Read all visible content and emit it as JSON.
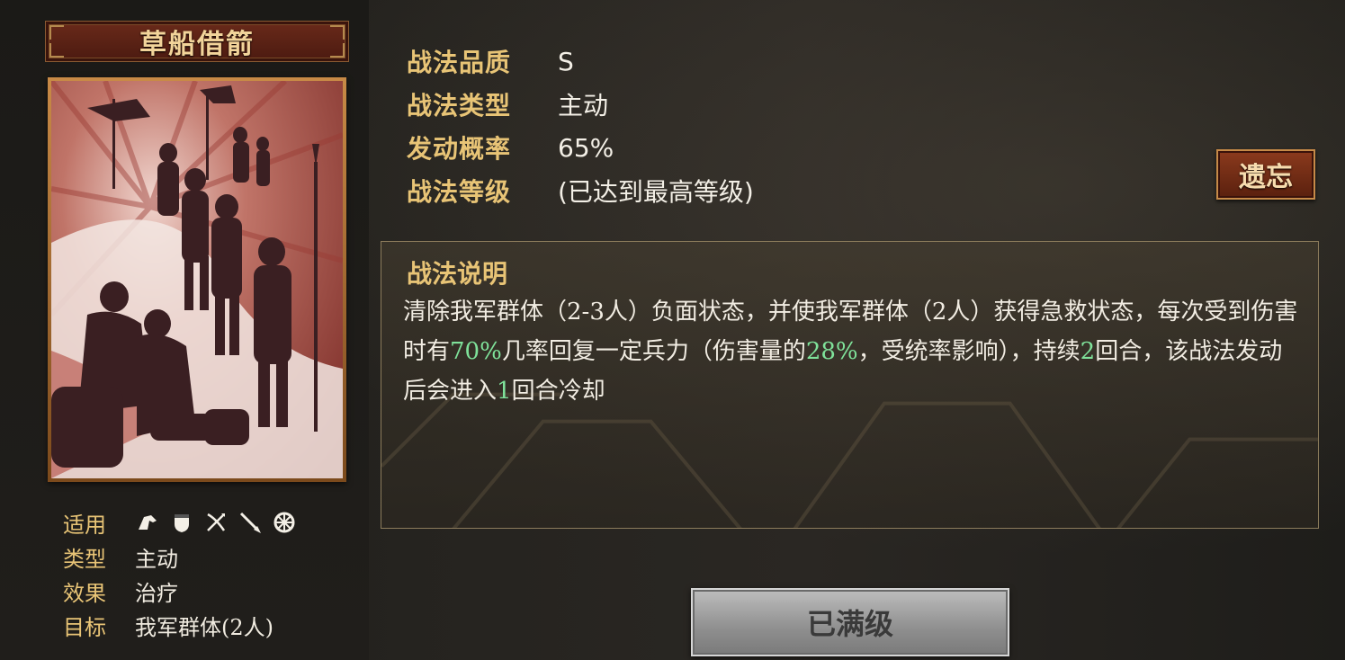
{
  "skill": {
    "name": "草船借箭"
  },
  "meta": {
    "applicable_label": "适用",
    "troop_icons": [
      "cavalry-icon",
      "shield-icon",
      "archer-icon",
      "spear-icon",
      "siege-icon"
    ],
    "type_label": "类型",
    "type_value": "主动",
    "effect_label": "效果",
    "effect_value": "治疗",
    "target_label": "目标",
    "target_value": "我军群体(2人)"
  },
  "attributes": [
    {
      "label": "战法品质",
      "value": "S"
    },
    {
      "label": "战法类型",
      "value": "主动"
    },
    {
      "label": "发动概率",
      "value": "65%"
    },
    {
      "label": "战法等级",
      "value": "(已达到最高等级)"
    }
  ],
  "buttons": {
    "forget": "遗忘",
    "max_level": "已满级"
  },
  "description": {
    "title": "战法说明",
    "p1": "清除我军群体（2-3人）负面状态，并使我军群体（2人）获得急救状态，每次受到伤害时有",
    "p1_hl": "70%",
    "p2": "几率回复一定兵力（伤害量的",
    "p2_hl": "28%",
    "p3": "，受统率影响），持续",
    "p3_hl": "2",
    "p4": "回合，该战法发动后会进入",
    "p4_hl": "1",
    "p5": "回合冷却"
  },
  "colors": {
    "label_gold": "#e8c476",
    "highlight_green": "#7fe29a",
    "banner_red": "#5a200e"
  }
}
